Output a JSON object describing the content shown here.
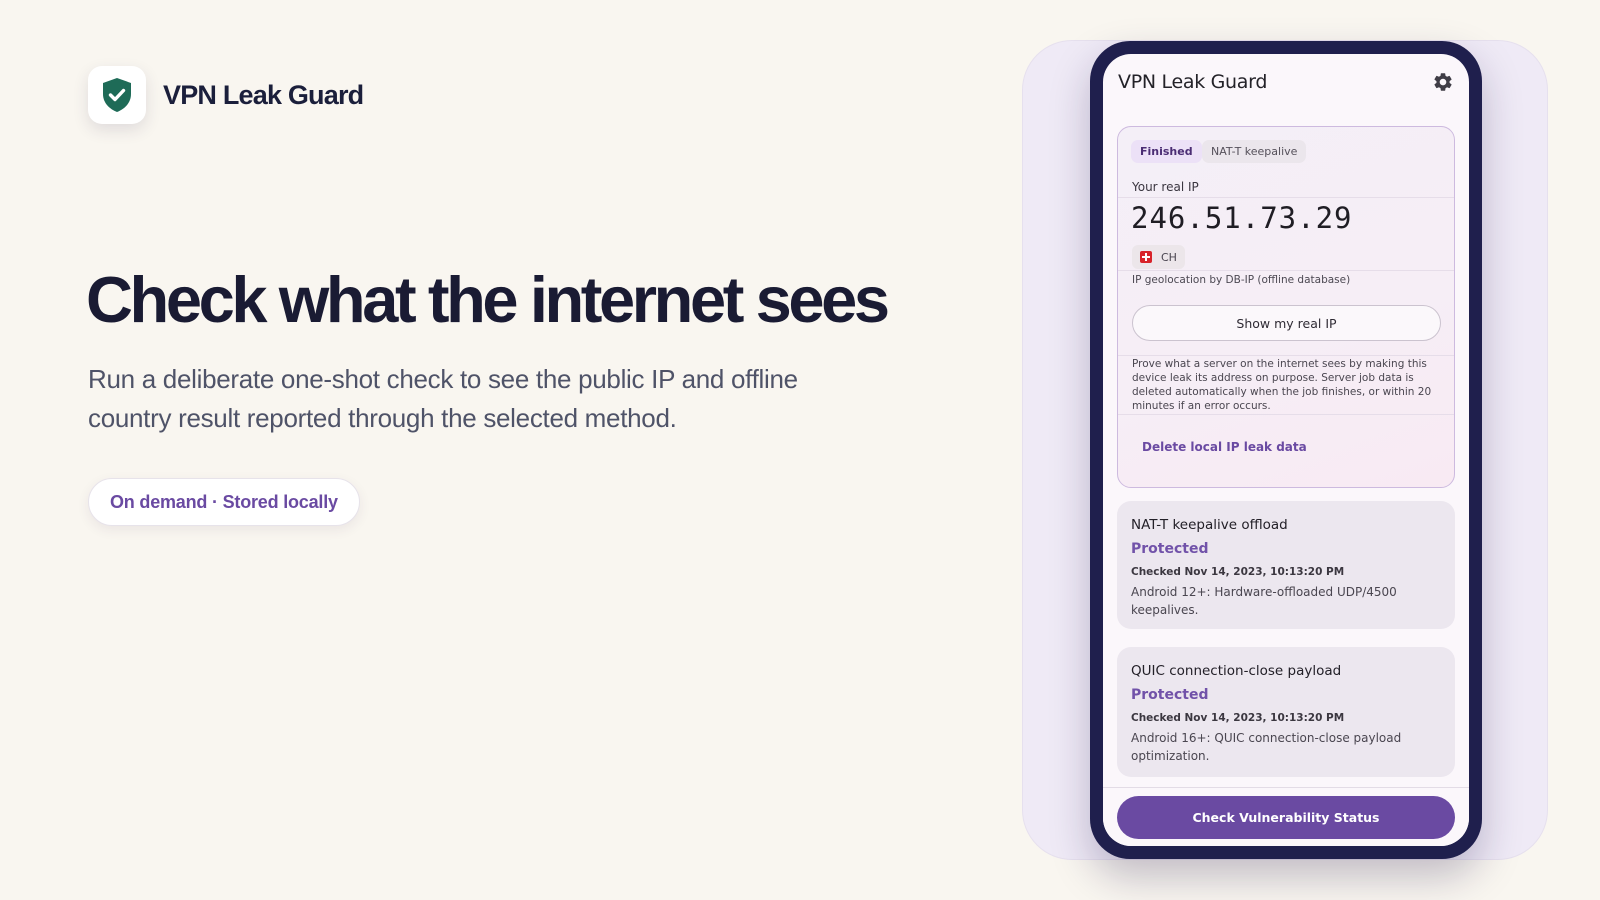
{
  "brand": {
    "name": "VPN Leak Guard",
    "logo_icon": "shield-check-icon"
  },
  "hero": {
    "headline": "Check what the internet sees",
    "subtitle": "Run a deliberate one-shot check to see the public IP and offline country result reported through the selected method.",
    "pill": "On demand · Stored locally"
  },
  "colors": {
    "accent": "#6a4aa2",
    "phone_frame": "#1f1f4d",
    "background": "#f9f6f0",
    "shield": "#1e6b57"
  },
  "app": {
    "title": "VPN Leak Guard",
    "settings_icon": "gear-icon",
    "leak_card": {
      "status_chip": "Finished",
      "method_chip": "NAT-T keepalive",
      "real_ip_label": "Your real IP",
      "real_ip": "246.51.73.29",
      "country_code": "CH",
      "geo_note": "IP geolocation by DB-IP (offline database)",
      "show_button": "Show my real IP",
      "description": "Prove what a server on the internet sees by making this device leak its address on purpose. Server job data is deleted automatically when the job finishes, or within 20 minutes if an error occurs.",
      "delete_link": "Delete local IP leak data"
    },
    "results": [
      {
        "title": "NAT-T keepalive offload",
        "status": "Protected",
        "checked": "Checked Nov 14, 2023, 10:13:20 PM",
        "description": "Android 12+: Hardware-offloaded UDP/4500 keepalives."
      },
      {
        "title": "QUIC connection-close payload",
        "status": "Protected",
        "checked": "Checked Nov 14, 2023, 10:13:20 PM",
        "description": "Android 16+: QUIC connection-close payload optimization."
      }
    ],
    "primary_button": "Check Vulnerability Status"
  }
}
